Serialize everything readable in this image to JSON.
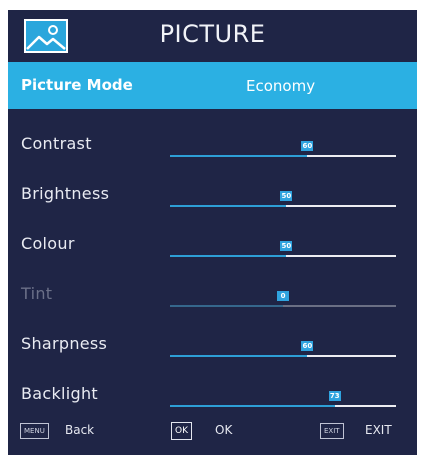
{
  "header": {
    "title": "PICTURE",
    "icon": "picture-icon"
  },
  "picture_mode": {
    "label": "Picture Mode",
    "value": "Economy"
  },
  "settings": [
    {
      "label": "Contrast",
      "value": 60,
      "max": 100,
      "disabled": false
    },
    {
      "label": "Brightness",
      "value": 50,
      "max": 100,
      "disabled": false
    },
    {
      "label": "Colour",
      "value": 50,
      "max": 100,
      "disabled": false
    },
    {
      "label": "Tint",
      "value": 0,
      "max": 100,
      "disabled": true
    },
    {
      "label": "Sharpness",
      "value": 60,
      "max": 100,
      "disabled": false
    },
    {
      "label": "Backlight",
      "value": 73,
      "max": 100,
      "disabled": false
    }
  ],
  "footer": {
    "back_key": "MENU",
    "back_label": "Back",
    "ok_key": "OK",
    "ok_label": "OK",
    "exit_key": "EXIT",
    "exit_label": "EXIT"
  },
  "colors": {
    "background": "#1f2546",
    "highlight": "#2bb0e3",
    "slider_fill": "#2d9fd6"
  }
}
